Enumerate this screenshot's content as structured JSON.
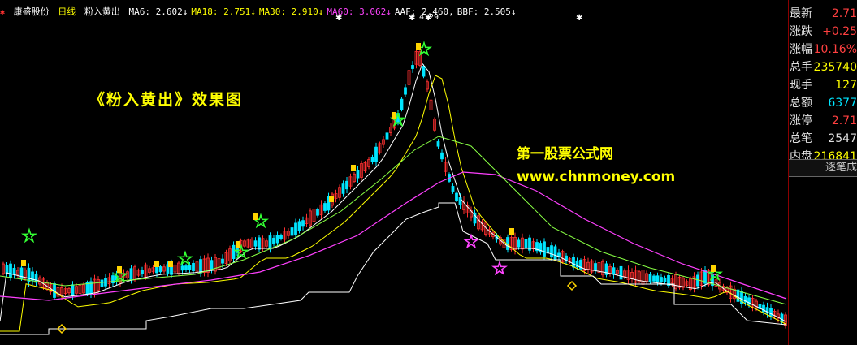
{
  "header": {
    "stock_name": "康盛股份",
    "period": "日线",
    "indicator": "粉入黄出",
    "ma": [
      {
        "label": "MA6: 2.602",
        "arrow": "↓",
        "color": "#ffffff"
      },
      {
        "label": "MA18: 2.751",
        "arrow": "↓",
        "color": "#ffff00"
      },
      {
        "label": "MA30: 2.910",
        "arrow": "↓",
        "color": "#ffff00"
      },
      {
        "label": "MA60: 3.062",
        "arrow": "↓",
        "color": "#ff44ff"
      },
      {
        "label": "AAF: 2.460,",
        "arrow": "",
        "color": "#ffffff"
      },
      {
        "label": "BBF: 2.505",
        "arrow": "↓",
        "color": "#ffffff"
      }
    ],
    "peak_label": "4.29"
  },
  "overlay": {
    "title": "《粉入黄出》效果图",
    "site_name": "第一股票公式网",
    "site_url": "www.chnmoney.com"
  },
  "quote": [
    {
      "label": "最新",
      "value": "2.71",
      "color": "#ff4040"
    },
    {
      "label": "涨跌",
      "value": "+0.25",
      "color": "#ff4040"
    },
    {
      "label": "涨幅",
      "value": "10.16%",
      "color": "#ff4040"
    },
    {
      "label": "总手",
      "value": "235740",
      "color": "#ffff00"
    },
    {
      "label": "现手",
      "value": "127",
      "color": "#ffff00"
    },
    {
      "label": "总额",
      "value": "6377",
      "color": "#00e5ff"
    },
    {
      "label": "涨停",
      "value": "2.71",
      "color": "#ff4040"
    },
    {
      "label": "总笔",
      "value": "2547",
      "color": "#e0e0e0"
    },
    {
      "label": "内盘",
      "value": "216841",
      "color": "#ffff00"
    }
  ],
  "tab_label": "逐笔成",
  "colors": {
    "up": "#ff3030",
    "down": "#00e5ff",
    "ma_white": "#ffffff",
    "ma_yellow": "#ffff00",
    "ma_green": "#88ff44",
    "ma_magenta": "#ff40ff",
    "signal_star": "#33ff33",
    "sell_star": "#ff44ff",
    "marker": "#ffd400"
  }
}
